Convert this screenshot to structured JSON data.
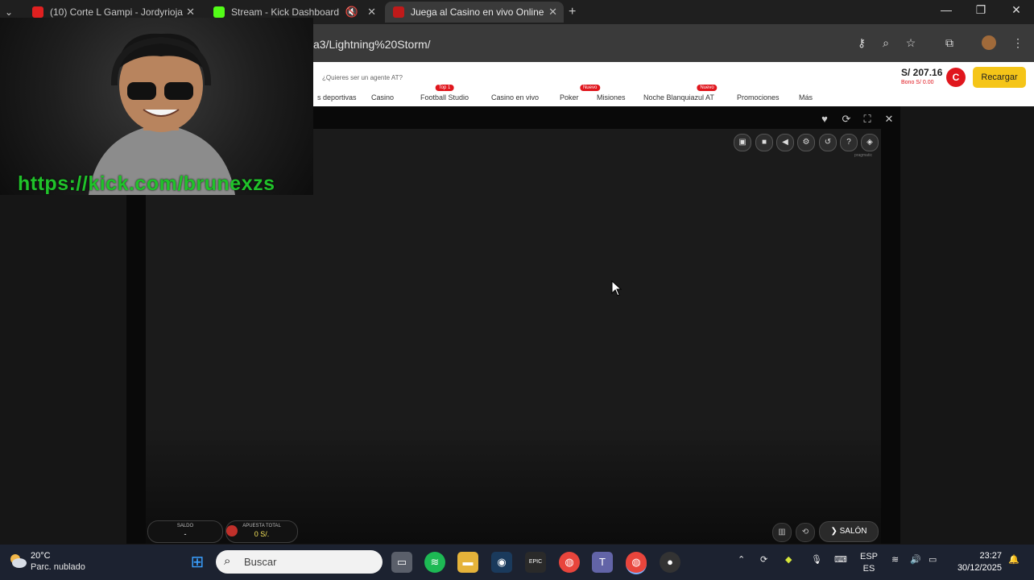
{
  "browser": {
    "tabs": [
      {
        "title": "(10) Corte L Gampi - Jordyrioja",
        "icon": "youtube-icon"
      },
      {
        "title": "Stream - Kick Dashboard",
        "icon": "kick-icon"
      },
      {
        "title": "Juega al Casino en vivo Online",
        "icon": "casino-site-icon"
      }
    ],
    "new_tab": "+",
    "url": "a3/Lightning%20Storm/"
  },
  "site": {
    "agent_prompt": "¿Quieres ser un agente AT?",
    "nav": [
      {
        "label": "s deportivas",
        "badge": ""
      },
      {
        "label": "Casino",
        "badge": ""
      },
      {
        "label": "Football Studio",
        "badge": "Top 1"
      },
      {
        "label": "Casino en vivo",
        "badge": ""
      },
      {
        "label": "Poker",
        "badge": "Nuevo"
      },
      {
        "label": "Misiones",
        "badge": ""
      },
      {
        "label": "Noche Blanquiazul AT",
        "badge": "Nuevo"
      },
      {
        "label": "Promociones",
        "badge": ""
      },
      {
        "label": "Más",
        "badge": ""
      }
    ],
    "balance": "S/ 207.16",
    "bono": "Bono S/ 0.00",
    "avatar_letter": "C",
    "recargar": "Recargar",
    "brand_red": "#e0161d",
    "brand_yellow": "#f5c518"
  },
  "game": {
    "saldo_label": "SALDO",
    "saldo_value": "-",
    "apuesta_label": "APUESTA TOTAL",
    "apuesta_value": "0 S/.",
    "salon": "SALÓN",
    "brand": "pragmatic"
  },
  "webcam": {
    "overlay_url": "https://kick.com/brunexzs"
  },
  "taskbar": {
    "temp": "20°C",
    "condition": "Parc. nublado",
    "search_placeholder": "Buscar",
    "lang_top": "ESP",
    "lang_bottom": "ES",
    "time": "23:27",
    "date": "30/12/2025"
  }
}
